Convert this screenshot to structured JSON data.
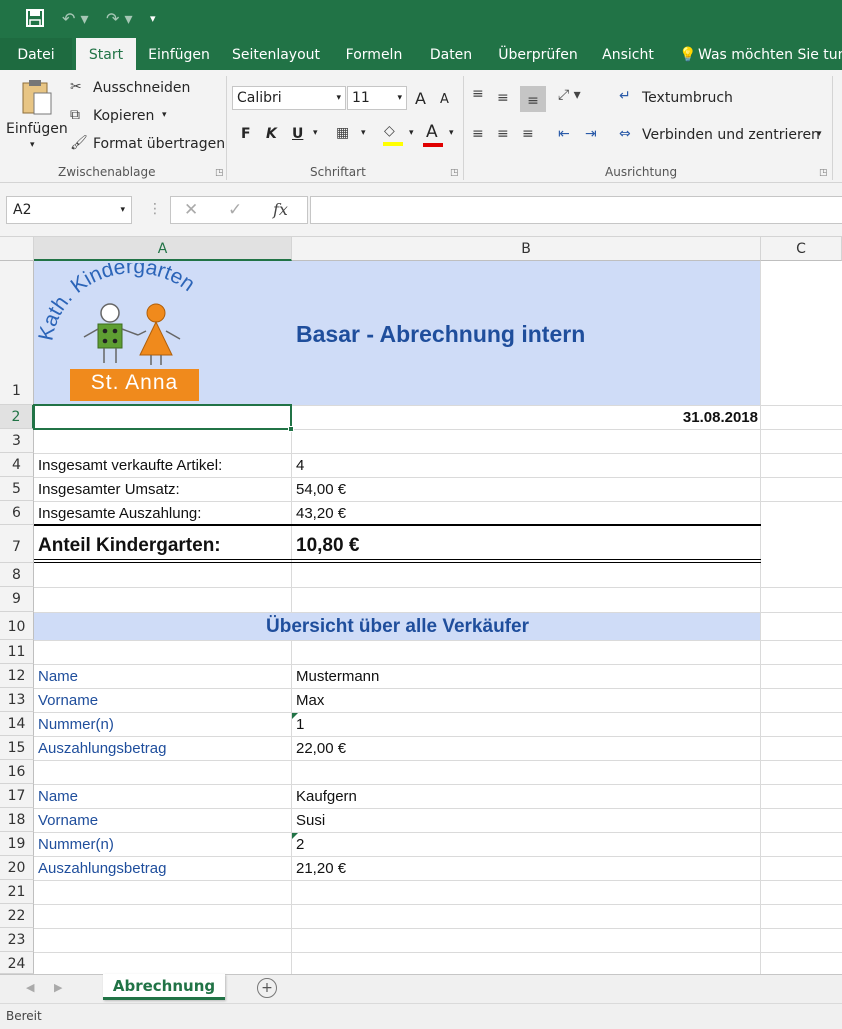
{
  "quick_access": {
    "save_icon": "save-icon",
    "undo_icon": "undo-icon",
    "redo_icon": "redo-icon",
    "customize_icon": "customize-icon"
  },
  "ribbon_tabs": [
    "Datei",
    "Start",
    "Einfügen",
    "Seitenlayout",
    "Formeln",
    "Daten",
    "Überprüfen",
    "Ansicht",
    "Was möchten Sie tun"
  ],
  "ribbon": {
    "clipboard": {
      "paste": "Einfügen",
      "cut": "Ausschneiden",
      "copy": "Kopieren",
      "format_painter": "Format übertragen",
      "group": "Zwischenablage"
    },
    "font": {
      "name": "Calibri",
      "size": "11",
      "bold": "F",
      "italic": "K",
      "underline": "U",
      "grow": "A",
      "shrink": "A",
      "color_letter": "A",
      "group": "Schriftart"
    },
    "alignment": {
      "wrap": "Textumbruch",
      "merge": "Verbinden und zentrieren",
      "group": "Ausrichtung"
    }
  },
  "formula_bar": {
    "name_box": "A2",
    "fx": "fx",
    "content": ""
  },
  "columns": [
    "A",
    "B",
    "C"
  ],
  "rows": [
    "1",
    "2",
    "3",
    "4",
    "5",
    "6",
    "7",
    "8",
    "9",
    "10",
    "11",
    "12",
    "13",
    "14",
    "15",
    "16",
    "17",
    "18",
    "19",
    "20",
    "21",
    "22",
    "23",
    "24"
  ],
  "logo": {
    "arc_text": "Kath. Kindergarten",
    "banner": "St. Anna"
  },
  "sheet": {
    "title": "Basar - Abrechnung intern",
    "date": "31.08.2018",
    "summary": [
      {
        "label": "Insgesamt verkaufte Artikel:",
        "value": "4"
      },
      {
        "label": "Insgesamter Umsatz:",
        "value": "54,00 €"
      },
      {
        "label": "Insgesamte Auszahlung:",
        "value": "43,20 €"
      }
    ],
    "share_label": "Anteil Kindergarten:",
    "share_value": "10,80 €",
    "overview_title": "Übersicht über alle Verkäufer",
    "sellers": [
      {
        "name_label": "Name",
        "name": "Mustermann",
        "first_label": "Vorname",
        "first": "Max",
        "num_label": "Nummer(n)",
        "num": "1",
        "pay_label": "Auszahlungsbetrag",
        "pay": "22,00 €"
      },
      {
        "name_label": "Name",
        "name": "Kaufgern",
        "first_label": "Vorname",
        "first": "Susi",
        "num_label": "Nummer(n)",
        "num": "2",
        "pay_label": "Auszahlungsbetrag",
        "pay": "21,20 €"
      }
    ]
  },
  "sheet_tab": "Abrechnung",
  "add_sheet_icon": "add-sheet-icon",
  "status": "Bereit",
  "colors": {
    "excel_green": "#217346",
    "header_fill": "#cfdcf7",
    "title_blue": "#1f4e9c"
  }
}
